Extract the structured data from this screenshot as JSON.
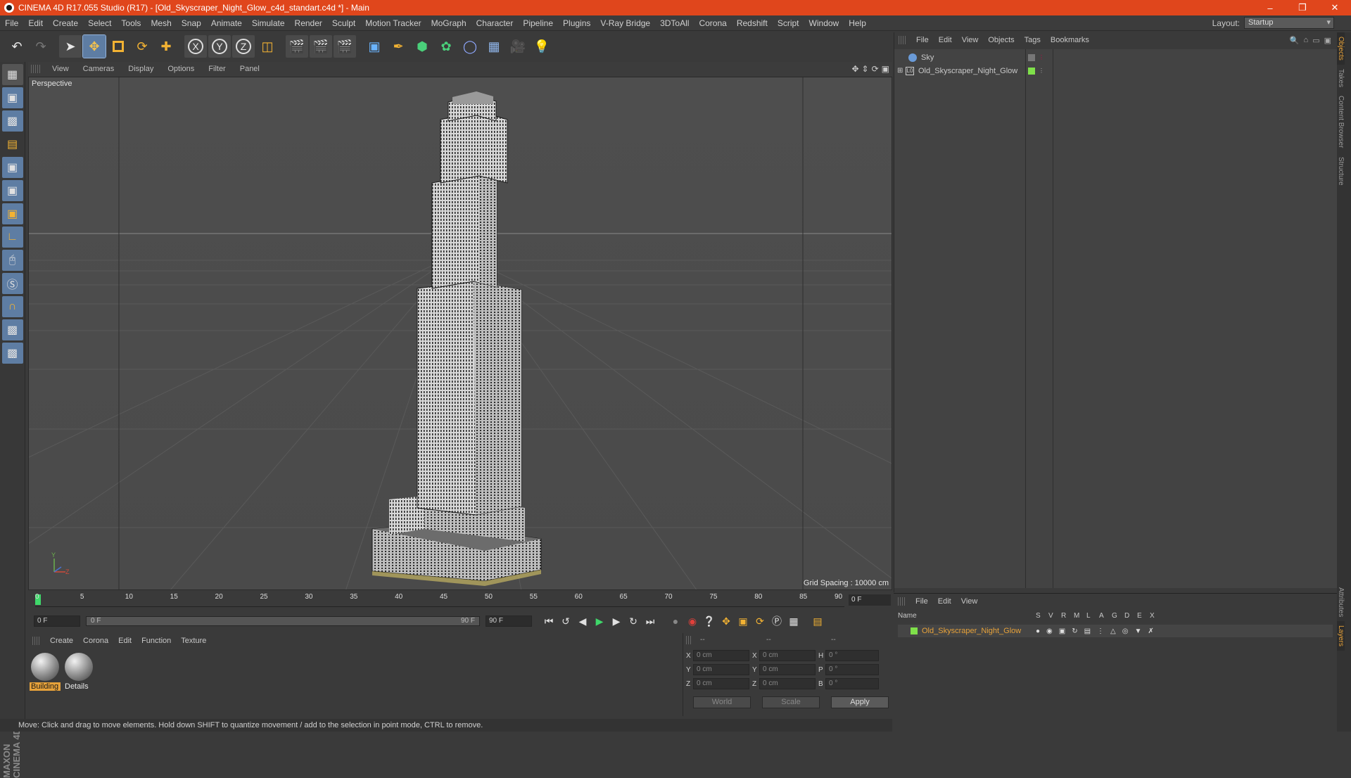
{
  "window": {
    "title": "CINEMA 4D R17.055 Studio (R17) - [Old_Skyscraper_Night_Glow_c4d_standart.c4d *] - Main",
    "minimize": "–",
    "restore": "❐",
    "close": "✕"
  },
  "menu": [
    "File",
    "Edit",
    "Create",
    "Select",
    "Tools",
    "Mesh",
    "Snap",
    "Animate",
    "Simulate",
    "Render",
    "Sculpt",
    "Motion Tracker",
    "MoGraph",
    "Character",
    "Pipeline",
    "Plugins",
    "V-Ray Bridge",
    "3DToAll",
    "Corona",
    "Redshift",
    "Script",
    "Window",
    "Help"
  ],
  "layout": {
    "label": "Layout:",
    "value": "Startup"
  },
  "viewport": {
    "menu": [
      "View",
      "Cameras",
      "Display",
      "Options",
      "Filter",
      "Panel"
    ],
    "camera": "Perspective",
    "grid_spacing": "Grid Spacing : 10000 cm"
  },
  "object_manager": {
    "menu": [
      "File",
      "Edit",
      "View",
      "Objects",
      "Tags",
      "Bookmarks"
    ],
    "objects": [
      {
        "name": "Sky",
        "color": "#c8c8c8"
      },
      {
        "name": "Old_Skyscraper_Night_Glow",
        "color": "#c8c8c8",
        "tag_color": "#7fe04a"
      }
    ]
  },
  "side_tabs": [
    "Objects",
    "Takes",
    "Content Browser",
    "Structure"
  ],
  "side_tabs_bottom": [
    "Attributes",
    "Layers"
  ],
  "timeline": {
    "ticks": [
      "0",
      "5",
      "10",
      "15",
      "20",
      "25",
      "30",
      "35",
      "40",
      "45",
      "50",
      "55",
      "60",
      "65",
      "70",
      "75",
      "80",
      "85",
      "90"
    ],
    "current_frame": "0 F",
    "start": "0 F",
    "range_start": "0 F",
    "range_end": "90 F",
    "end": "90 F"
  },
  "material_manager": {
    "menu": [
      "Create",
      "Corona",
      "Edit",
      "Function",
      "Texture"
    ],
    "materials": [
      {
        "name": "Building",
        "selected": true
      },
      {
        "name": "Details",
        "selected": false
      }
    ]
  },
  "coordinates": {
    "headers": [
      "--",
      "--",
      "--"
    ],
    "rows": [
      {
        "axis": "X",
        "pos": "0 cm",
        "axis2": "X",
        "size": "0 cm",
        "axis3": "H",
        "rot": "0 °"
      },
      {
        "axis": "Y",
        "pos": "0 cm",
        "axis2": "Y",
        "size": "0 cm",
        "axis3": "P",
        "rot": "0 °"
      },
      {
        "axis": "Z",
        "pos": "0 cm",
        "axis2": "Z",
        "size": "0 cm",
        "axis3": "B",
        "rot": "0 °"
      }
    ],
    "world": "World",
    "scale": "Scale",
    "apply": "Apply"
  },
  "layer_manager": {
    "menu": [
      "File",
      "Edit",
      "View"
    ],
    "columns": [
      "Name",
      "S",
      "V",
      "R",
      "M",
      "L",
      "A",
      "G",
      "D",
      "E",
      "X"
    ],
    "layers": [
      {
        "name": "Old_Skyscraper_Night_Glow",
        "color": "#e7a23a"
      }
    ]
  },
  "status": "Move: Click and drag to move elements. Hold down SHIFT to quantize movement / add to the selection in point mode, CTRL to remove."
}
